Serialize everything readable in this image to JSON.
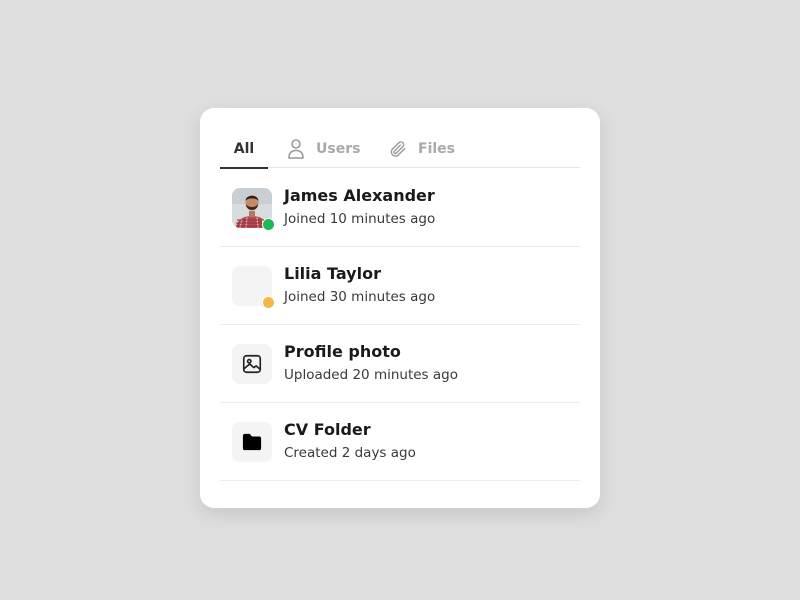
{
  "tabs": [
    {
      "label": "All",
      "icon": "",
      "active": true
    },
    {
      "label": "Users",
      "icon": "user-icon",
      "active": false
    },
    {
      "label": "Files",
      "icon": "paperclip-icon",
      "active": false
    }
  ],
  "items": [
    {
      "title": "James Alexander",
      "subtitle": "Joined 10 minutes ago",
      "thumb": "avatar-photo",
      "status_color": "#1db954"
    },
    {
      "title": "Lilia Taylor",
      "subtitle": "Joined 30 minutes ago",
      "thumb": "avatar-placeholder",
      "status_color": "#f0b94a"
    },
    {
      "title": "Profile photo",
      "subtitle": "Uploaded 20 minutes ago",
      "thumb": "image-icon"
    },
    {
      "title": "CV Folder",
      "subtitle": "Created 2 days ago",
      "thumb": "folder-icon"
    }
  ],
  "colors": {
    "background": "#dedede",
    "card": "#ffffff",
    "active_tab": "#333333",
    "inactive_tab": "#a9a9a9",
    "online": "#1db954",
    "away": "#f0b94a"
  }
}
